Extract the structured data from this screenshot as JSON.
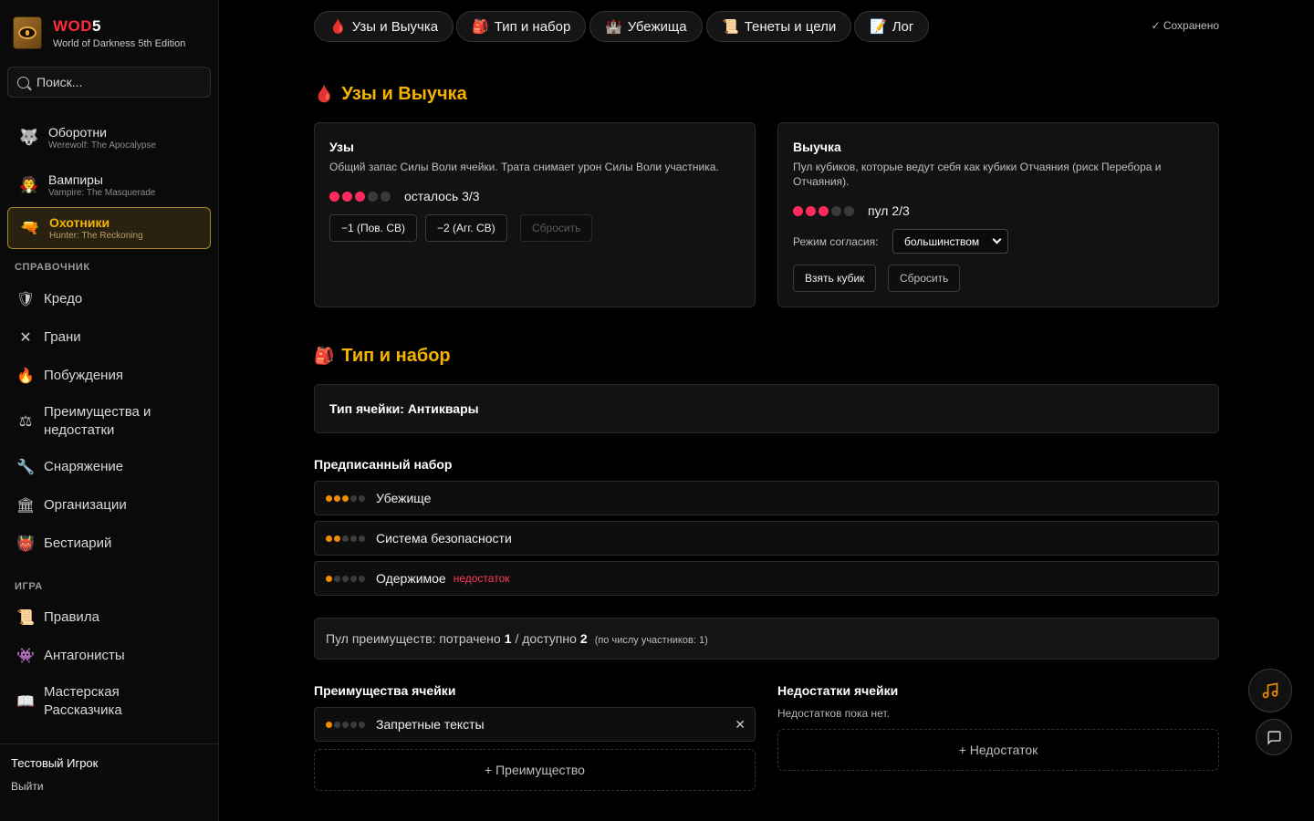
{
  "brand": {
    "title_red": "WOD",
    "title_white": "5",
    "subtitle": "World of Darkness 5th Edition"
  },
  "search": {
    "placeholder": "Поиск..."
  },
  "games": [
    {
      "title": "Оборотни",
      "subtitle": "Werewolf: The Apocalypse",
      "icon": "wolf-icon",
      "glyph": "🐺"
    },
    {
      "title": "Вампиры",
      "subtitle": "Vampire: The Masquerade",
      "icon": "vampire-icon",
      "glyph": "🧛"
    },
    {
      "title": "Охотники",
      "subtitle": "Hunter: The Reckoning",
      "icon": "pistol-icon",
      "glyph": "🔫",
      "active": true
    }
  ],
  "reference": {
    "label": "СПРАВОЧНИК",
    "items": [
      {
        "label": "Кредо",
        "icon": "shield-icon",
        "glyph": "🛡"
      },
      {
        "label": "Грани",
        "icon": "cross-icon",
        "glyph": "✕"
      },
      {
        "label": "Побуждения",
        "icon": "fire-icon",
        "glyph": "🔥"
      },
      {
        "label": "Преимущества и недостатки",
        "icon": "scales-icon",
        "glyph": "⚖"
      },
      {
        "label": "Снаряжение",
        "icon": "wrench-icon",
        "glyph": "🔧"
      },
      {
        "label": "Организации",
        "icon": "building-icon",
        "glyph": "🏛"
      },
      {
        "label": "Бестиарий",
        "icon": "demon-icon",
        "glyph": "👹"
      }
    ]
  },
  "game_section": {
    "label": "ИГРА",
    "items": [
      {
        "label": "Правила",
        "icon": "scroll-icon",
        "glyph": "📜"
      },
      {
        "label": "Антагонисты",
        "icon": "monster-icon",
        "glyph": "👾"
      },
      {
        "label": "Мастерская Рассказчика",
        "icon": "book-icon",
        "glyph": "📖"
      }
    ]
  },
  "user": {
    "name": "Тестовый Игрок",
    "logout": "Выйти"
  },
  "tabs": [
    {
      "label": "Узы и Выучка",
      "glyph": "🩸"
    },
    {
      "label": "Тип и набор",
      "glyph": "🎒"
    },
    {
      "label": "Убежища",
      "glyph": "🏰"
    },
    {
      "label": "Тенеты и цели",
      "glyph": "📜"
    },
    {
      "label": "Лог",
      "glyph": "📝"
    }
  ],
  "saved_status": "✓ Сохранено",
  "bonds": {
    "section_title": "Узы и Выучка",
    "section_glyph": "🩸",
    "uzy": {
      "title": "Узы",
      "description": "Общий запас Силы Воли ячейки. Трата снимает урон Силы Воли участника.",
      "filled": 3,
      "total": 5,
      "status": "осталось 3/3",
      "btn_minus1": "−1 (Пов. СВ)",
      "btn_minus2": "−2 (Агг. СВ)",
      "btn_reset": "Сбросить"
    },
    "training": {
      "title": "Выучка",
      "description": "Пул кубиков, которые ведут себя как кубики Отчаяния (риск Перебора и Отчаяния).",
      "filled": 3,
      "total": 5,
      "status": "пул 2/3",
      "consent_label": "Режим согласия:",
      "consent_value": "большинством",
      "btn_take": "Взять кубик",
      "btn_reset": "Сбросить"
    },
    "accent_dot_color": "#ff2b5e"
  },
  "type_kit": {
    "section_title": "Тип и набор",
    "section_glyph": "🎒",
    "cell_type": "Тип ячейки: Антиквары",
    "prescribed_title": "Предписанный набор",
    "prescribed": [
      {
        "label": "Убежище",
        "filled": 3,
        "tag": ""
      },
      {
        "label": "Система безопасности",
        "filled": 2,
        "tag": ""
      },
      {
        "label": "Одержимое",
        "filled": 1,
        "tag": "недостаток"
      }
    ],
    "pool": {
      "prefix": "Пул преимуществ: потрачено",
      "spent": "1",
      "middle": "/ доступно",
      "available": "2",
      "note": "(по числу участников: 1)"
    },
    "advantages_title": "Преимущества ячейки",
    "advantages": [
      {
        "label": "Запретные тексты",
        "filled": 1
      }
    ],
    "add_advantage": "+ Преимущество",
    "flaws_title": "Недостатки ячейки",
    "flaws_empty": "Недостатков пока нет.",
    "add_flaw": "+ Недостаток"
  },
  "colors": {
    "accent": "#f5b400",
    "merit_dot": "#f08c00",
    "flaw_tag": "#ff3d55"
  }
}
